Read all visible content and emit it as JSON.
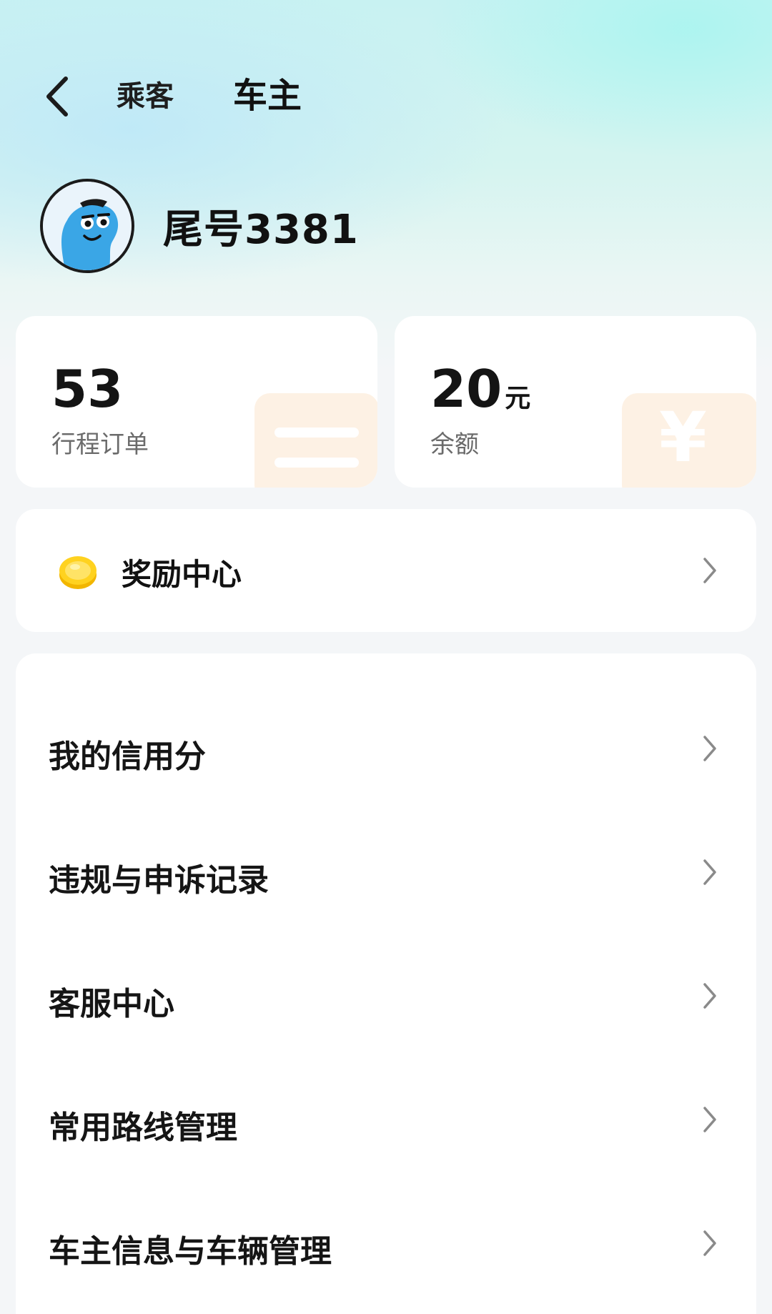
{
  "nav": {
    "tabs": [
      {
        "label": "乘客",
        "active": false
      },
      {
        "label": "车主",
        "active": true
      }
    ],
    "accent_color": "#3fd6b8"
  },
  "profile": {
    "username": "尾号3381"
  },
  "stats": {
    "orders": {
      "value": "53",
      "label": "行程订单"
    },
    "balance": {
      "value": "20",
      "unit": "元",
      "label": "余额"
    },
    "deco_symbol": "¥"
  },
  "reward": {
    "label": "奖励中心",
    "icon": "coin-icon"
  },
  "menu": {
    "items": [
      {
        "label": "我的信用分"
      },
      {
        "label": "违规与申诉记录"
      },
      {
        "label": "客服中心"
      },
      {
        "label": "常用路线管理"
      },
      {
        "label": "车主信息与车辆管理"
      }
    ]
  }
}
